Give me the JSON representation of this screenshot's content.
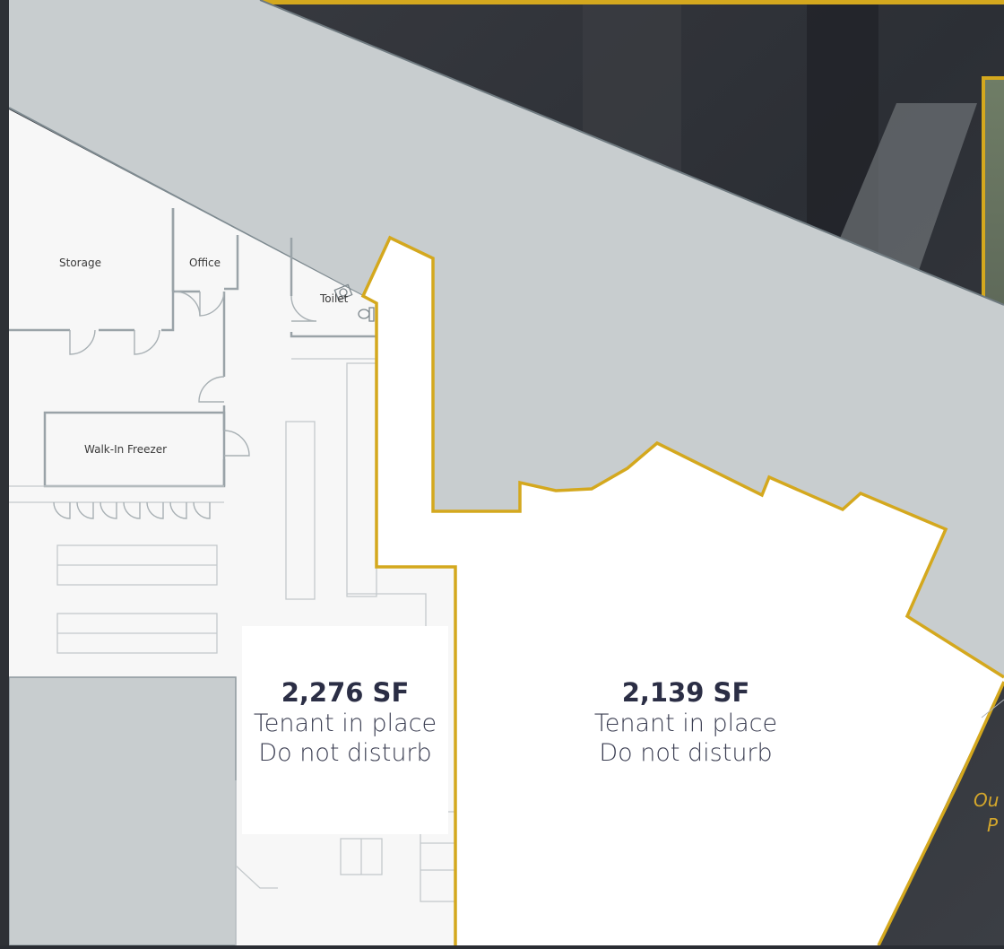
{
  "colors": {
    "accent": "#d4a81e",
    "common_area": "#c8cdcf",
    "floor": "#f7f7f7",
    "wall": "#9aa3a8",
    "text_dark": "#2b2e45"
  },
  "rooms": {
    "storage": "Storage",
    "office": "Office",
    "toilet": "Toilet",
    "walk_in_freezer": "Walk-In Freezer"
  },
  "units": [
    {
      "area": "2,276 SF",
      "status": "Tenant in place",
      "note": "Do not disturb"
    },
    {
      "area": "2,139 SF",
      "status": "Tenant in place",
      "note": "Do not disturb"
    }
  ],
  "caption": {
    "line1": "Ou",
    "line2": "P"
  },
  "icons": [
    "toilet-icon",
    "sink-icon",
    "door-swing-icon"
  ]
}
